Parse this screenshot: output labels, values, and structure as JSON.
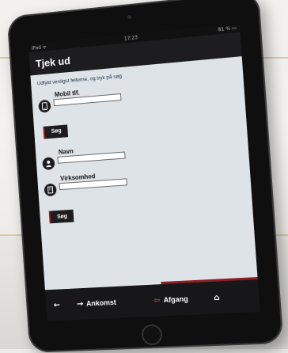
{
  "device": {
    "status_left": "iPad ᯤ",
    "status_center": "17:23",
    "status_right": "81 % ▭"
  },
  "header": {
    "title": "Tjek ud"
  },
  "form": {
    "instruction": "Udfyld venligst felterne, og tryk på søg",
    "mobile_label": "Mobil tlf.",
    "mobile_value": "",
    "search_button_1": "Søg",
    "name_label": "Navn",
    "name_value": "",
    "company_label": "Virksomhed",
    "company_value": "",
    "search_button_2": "Søg"
  },
  "bottom_nav": {
    "back_icon": "arrow-left-icon",
    "arrival_label": "Ankomst",
    "departure_label": "Afgang",
    "home_icon": "home-icon"
  },
  "colors": {
    "accent": "#8c1d24",
    "bar": "#1d1d1f",
    "screen_bg": "#dde3e7"
  }
}
